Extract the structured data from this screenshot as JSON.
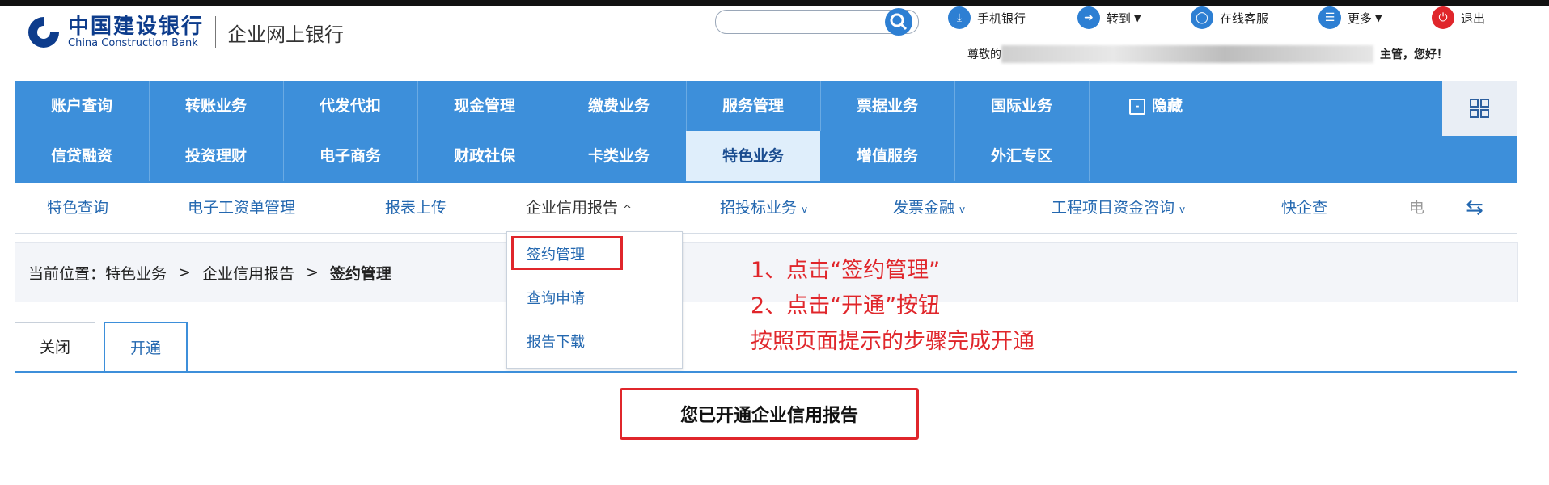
{
  "header": {
    "bank_name_cn": "中国建设银行",
    "bank_name_en": "China Construction Bank",
    "site_name": "企业网上银行",
    "search_placeholder": "",
    "tools": {
      "mobile": "手机银行",
      "goto": "转到",
      "service": "在线客服",
      "more": "更多",
      "logout": "退出"
    },
    "welcome_prefix": "尊敬的",
    "welcome_suffix": "主管，您好！"
  },
  "nav": {
    "row1": [
      "账户查询",
      "转账业务",
      "代发代扣",
      "现金管理",
      "缴费业务",
      "服务管理",
      "票据业务",
      "国际业务"
    ],
    "row2": [
      "信贷融资",
      "投资理财",
      "电子商务",
      "财政社保",
      "卡类业务",
      "特色业务",
      "增值服务",
      "外汇专区"
    ],
    "hide_label": "隐藏",
    "active": "特色业务"
  },
  "subnav": {
    "items": [
      "特色查询",
      "电子工资单管理",
      "报表上传",
      "企业信用报告",
      "招投标业务",
      "发票金融",
      "工程项目资金咨询",
      "快企查"
    ],
    "overflow": "电"
  },
  "breadcrumb": {
    "prefix": "当前位置：",
    "level1": "特色业务",
    "level2": "企业信用报告",
    "current": "签约管理"
  },
  "dropdown": {
    "items": [
      "签约管理",
      "查询申请",
      "报告下载"
    ]
  },
  "annotation": {
    "line1": "1、点击“签约管理”",
    "line2": "2、点击“开通”按钮",
    "line3": "按照页面提示的步骤完成开通"
  },
  "tabs": {
    "close": "关闭",
    "open": "开通"
  },
  "status_message": "您已开通企业信用报告",
  "colors": {
    "nav_blue": "#3d8fda",
    "annotation_red": "#e0262b",
    "link_blue": "#2468b0"
  }
}
